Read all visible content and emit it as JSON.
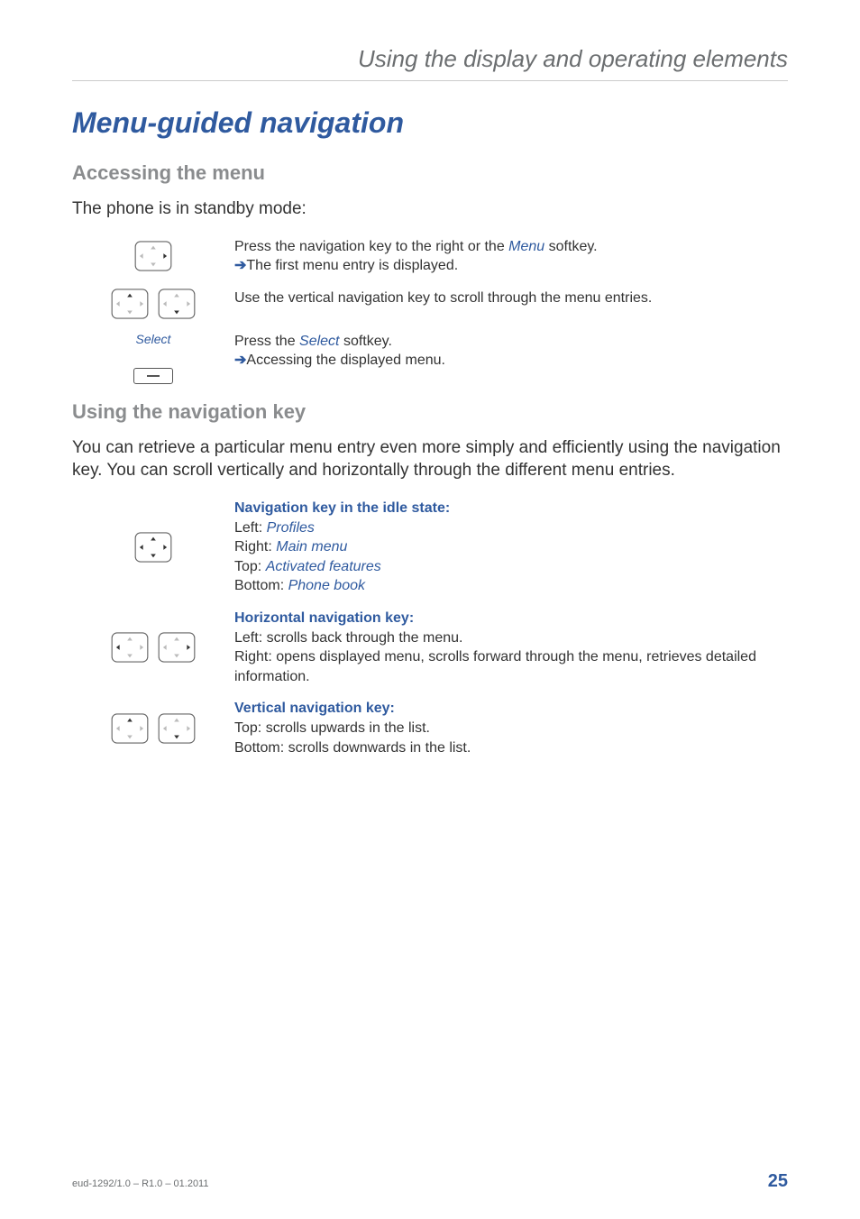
{
  "header": {
    "running_title": "Using the display and operating elements"
  },
  "main": {
    "title": "Menu-guided navigation",
    "section1": {
      "heading": "Accessing the menu",
      "intro": "The phone is in standby mode:",
      "rows": [
        {
          "text_pre": "Press the navigation key to the right or the ",
          "link": "Menu",
          "text_post": " softkey.",
          "arrow_line": "The first menu entry is displayed."
        },
        {
          "text": "Use the vertical navigation key to scroll through the menu entries."
        },
        {
          "softkey_label": "Select",
          "text_pre": "Press the ",
          "link": "Select",
          "text_post": " softkey.",
          "arrow_line": "Accessing the displayed menu."
        }
      ]
    },
    "section2": {
      "heading": "Using the navigation key",
      "intro": "You can retrieve a particular menu entry even more simply and efficiently using the navigation key. You can scroll vertically and horizontally through the different menu entries.",
      "rows": [
        {
          "bold_title": "Navigation key in the idle state:",
          "lines": [
            {
              "prefix": "Left: ",
              "link": "Profiles"
            },
            {
              "prefix": "Right: ",
              "link": "Main menu"
            },
            {
              "prefix": "Top: ",
              "link": "Activated features"
            },
            {
              "prefix": "Bottom: ",
              "link": "Phone book"
            }
          ]
        },
        {
          "bold_title": "Horizontal navigation key:",
          "plain_lines": [
            "Left: scrolls back through the menu.",
            "Right: opens displayed menu, scrolls forward through the menu, retrieves detailed information."
          ]
        },
        {
          "bold_title": "Vertical navigation key:",
          "plain_lines": [
            "Top: scrolls upwards in the list.",
            "Bottom: scrolls downwards in the list."
          ]
        }
      ]
    }
  },
  "footer": {
    "doc_id": "eud-1292/1.0 – R1.0 – 01.2011",
    "page_num": "25"
  },
  "icons": {
    "arrow": "➔"
  }
}
